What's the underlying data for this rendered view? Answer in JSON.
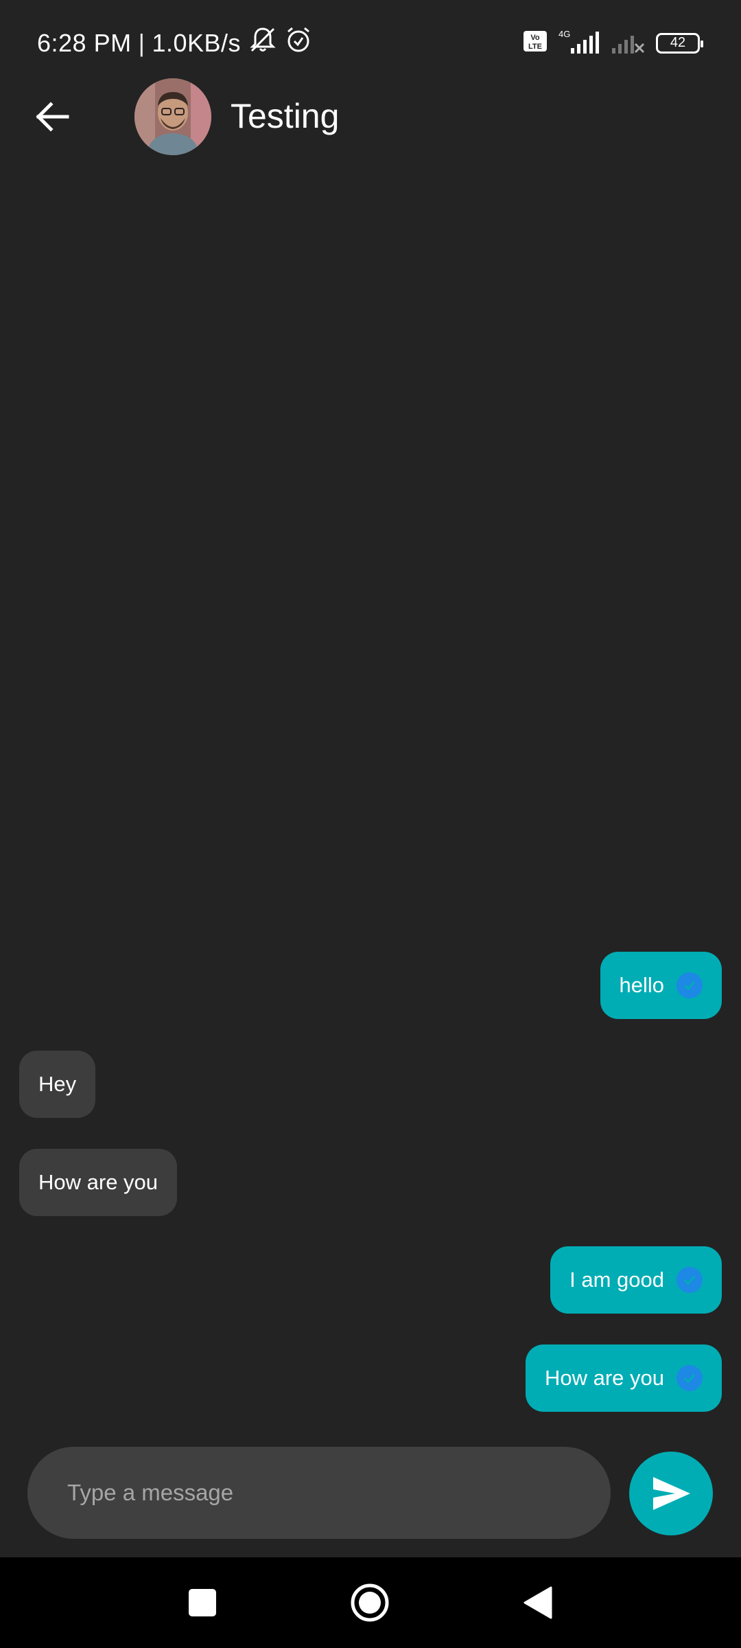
{
  "status_bar": {
    "time": "6:28 PM",
    "separator": "|",
    "net_speed": "1.0KB/s",
    "volte": "Vo LTE",
    "network_type": "4G",
    "battery_level": "42"
  },
  "header": {
    "contact_name": "Testing"
  },
  "messages": [
    {
      "text": "hello",
      "direction": "outgoing",
      "read": true
    },
    {
      "text": "Hey",
      "direction": "incoming"
    },
    {
      "text": "How are you",
      "direction": "incoming"
    },
    {
      "text": "I am good",
      "direction": "outgoing",
      "read": true
    },
    {
      "text": "How are you",
      "direction": "outgoing",
      "read": true
    }
  ],
  "composer": {
    "placeholder": "Type a message",
    "value": ""
  },
  "colors": {
    "background": "#232323",
    "outgoing_bubble": "#00adb5",
    "incoming_bubble": "#3d3d3d",
    "read_tick": "#1e88e5",
    "composer": "#404040",
    "nav_bar": "#000000"
  },
  "icons": {
    "back": "arrow-left-icon",
    "send": "send-icon",
    "mute": "bell-off-icon",
    "alarm": "alarm-icon",
    "nav_recents": "square-icon",
    "nav_home": "circle-icon",
    "nav_back": "triangle-back-icon"
  }
}
